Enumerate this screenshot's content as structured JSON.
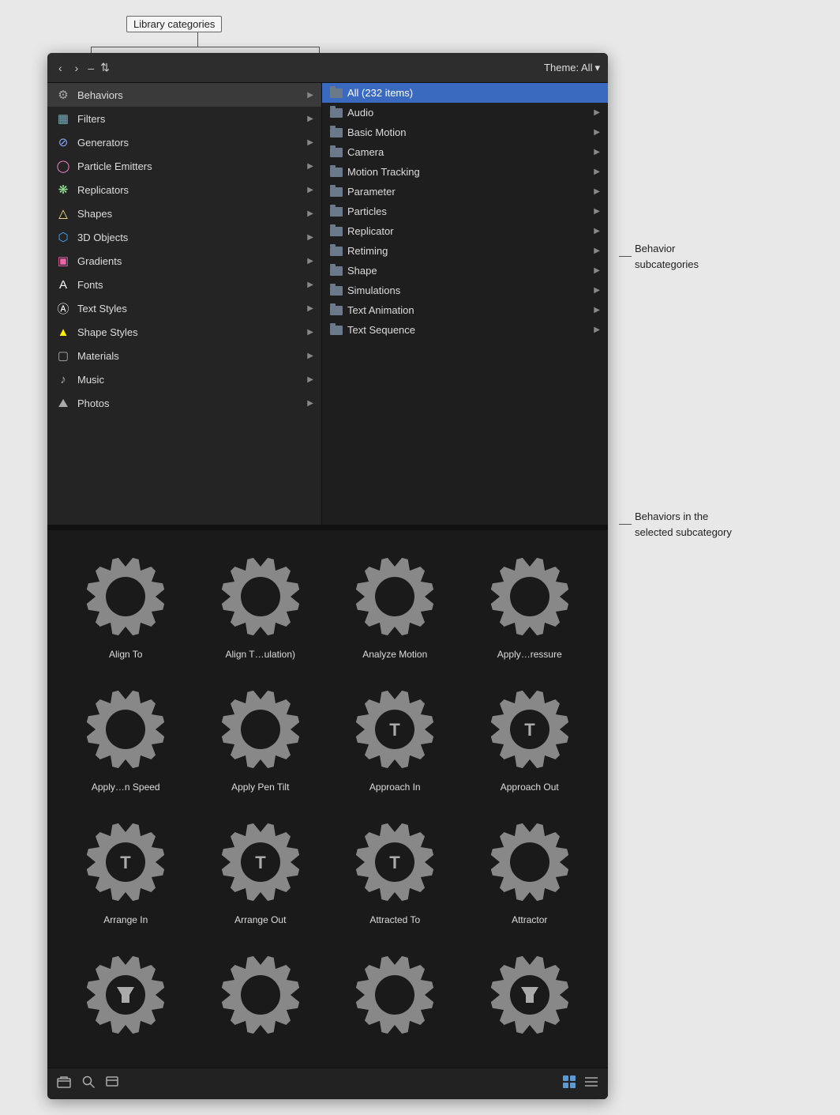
{
  "callout_top": "Library categories",
  "toolbar": {
    "back": "‹",
    "forward": "›",
    "dash": "–",
    "arrows": "⇅",
    "theme_label": "Theme: All",
    "theme_chevron": "▾"
  },
  "sidebar": {
    "items": [
      {
        "id": "behaviors",
        "label": "Behaviors",
        "icon": "⚙",
        "icon_color": "#aaa",
        "selected": true
      },
      {
        "id": "filters",
        "label": "Filters",
        "icon": "▦",
        "icon_color": "#7ab",
        "selected": false
      },
      {
        "id": "generators",
        "label": "Generators",
        "icon": "⊘",
        "icon_color": "#8af",
        "selected": false
      },
      {
        "id": "particle-emitters",
        "label": "Particle Emitters",
        "icon": "◯",
        "icon_color": "#f8c",
        "selected": false
      },
      {
        "id": "replicators",
        "label": "Replicators",
        "icon": "❋",
        "icon_color": "#9e9",
        "selected": false
      },
      {
        "id": "shapes",
        "label": "Shapes",
        "icon": "△",
        "icon_color": "#fe8",
        "selected": false
      },
      {
        "id": "3d-objects",
        "label": "3D Objects",
        "icon": "⬡",
        "icon_color": "#4af",
        "selected": false
      },
      {
        "id": "gradients",
        "label": "Gradients",
        "icon": "▣",
        "icon_color": "#e6a",
        "selected": false
      },
      {
        "id": "fonts",
        "label": "Fonts",
        "icon": "A",
        "icon_color": "#fff",
        "selected": false
      },
      {
        "id": "text-styles",
        "label": "Text Styles",
        "icon": "Ⓐ",
        "icon_color": "#fff",
        "selected": false
      },
      {
        "id": "shape-styles",
        "label": "Shape Styles",
        "icon": "▲",
        "icon_color": "#fe0",
        "selected": false
      },
      {
        "id": "materials",
        "label": "Materials",
        "icon": "▢",
        "icon_color": "#aaa",
        "selected": false
      },
      {
        "id": "music",
        "label": "Music",
        "icon": "♪",
        "icon_color": "#aaa",
        "selected": false
      },
      {
        "id": "photos",
        "label": "Photos",
        "icon": "⛰",
        "icon_color": "#aaa",
        "selected": false
      }
    ]
  },
  "categories": {
    "items": [
      {
        "id": "all",
        "label": "All (232 items)",
        "selected": true,
        "has_chevron": false
      },
      {
        "id": "audio",
        "label": "Audio",
        "selected": false,
        "has_chevron": true
      },
      {
        "id": "basic-motion",
        "label": "Basic Motion",
        "selected": false,
        "has_chevron": true
      },
      {
        "id": "camera",
        "label": "Camera",
        "selected": false,
        "has_chevron": true
      },
      {
        "id": "motion-tracking",
        "label": "Motion Tracking",
        "selected": false,
        "has_chevron": true
      },
      {
        "id": "parameter",
        "label": "Parameter",
        "selected": false,
        "has_chevron": true
      },
      {
        "id": "particles",
        "label": "Particles",
        "selected": false,
        "has_chevron": true
      },
      {
        "id": "replicator",
        "label": "Replicator",
        "selected": false,
        "has_chevron": true
      },
      {
        "id": "retiming",
        "label": "Retiming",
        "selected": false,
        "has_chevron": true
      },
      {
        "id": "shape",
        "label": "Shape",
        "selected": false,
        "has_chevron": true
      },
      {
        "id": "simulations",
        "label": "Simulations",
        "selected": false,
        "has_chevron": true
      },
      {
        "id": "text-animation",
        "label": "Text Animation",
        "selected": false,
        "has_chevron": true
      },
      {
        "id": "text-sequence",
        "label": "Text Sequence",
        "selected": false,
        "has_chevron": true
      }
    ]
  },
  "grid_items": [
    {
      "id": "align-to",
      "label": "Align To",
      "has_text": false,
      "has_filter": false
    },
    {
      "id": "align-t-ulation",
      "label": "Align T…ulation)",
      "has_text": false,
      "has_filter": false
    },
    {
      "id": "analyze-motion",
      "label": "Analyze Motion",
      "has_text": false,
      "has_filter": false
    },
    {
      "id": "apply-ressure",
      "label": "Apply…ressure",
      "has_text": false,
      "has_filter": false
    },
    {
      "id": "apply-n-speed",
      "label": "Apply…n Speed",
      "has_text": false,
      "has_filter": false
    },
    {
      "id": "apply-pen-tilt",
      "label": "Apply Pen Tilt",
      "has_text": false,
      "has_filter": false
    },
    {
      "id": "approach-in",
      "label": "Approach In",
      "has_text": true,
      "has_filter": false
    },
    {
      "id": "approach-out",
      "label": "Approach Out",
      "has_text": true,
      "has_filter": false
    },
    {
      "id": "arrange-in",
      "label": "Arrange In",
      "has_text": true,
      "has_filter": false
    },
    {
      "id": "arrange-out",
      "label": "Arrange Out",
      "has_text": true,
      "has_filter": false
    },
    {
      "id": "attracted-to",
      "label": "Attracted To",
      "has_text": true,
      "has_filter": false
    },
    {
      "id": "attractor",
      "label": "Attractor",
      "has_text": false,
      "has_filter": false
    },
    {
      "id": "item-13",
      "label": "",
      "has_text": false,
      "has_filter": true
    },
    {
      "id": "item-14",
      "label": "",
      "has_text": false,
      "has_filter": false
    },
    {
      "id": "item-15",
      "label": "",
      "has_text": false,
      "has_filter": false
    },
    {
      "id": "item-16",
      "label": "",
      "has_text": false,
      "has_filter": true
    }
  ],
  "bottom_bar": {
    "add_icon": "📁",
    "search_icon": "🔍",
    "info_icon": "▣",
    "grid_icon": "⊞",
    "list_icon": "≡"
  },
  "callouts": {
    "behavior_subcategories": "Behavior\nsubcategories",
    "behaviors_in_selected": "Behaviors in the\nselected subcategory"
  }
}
